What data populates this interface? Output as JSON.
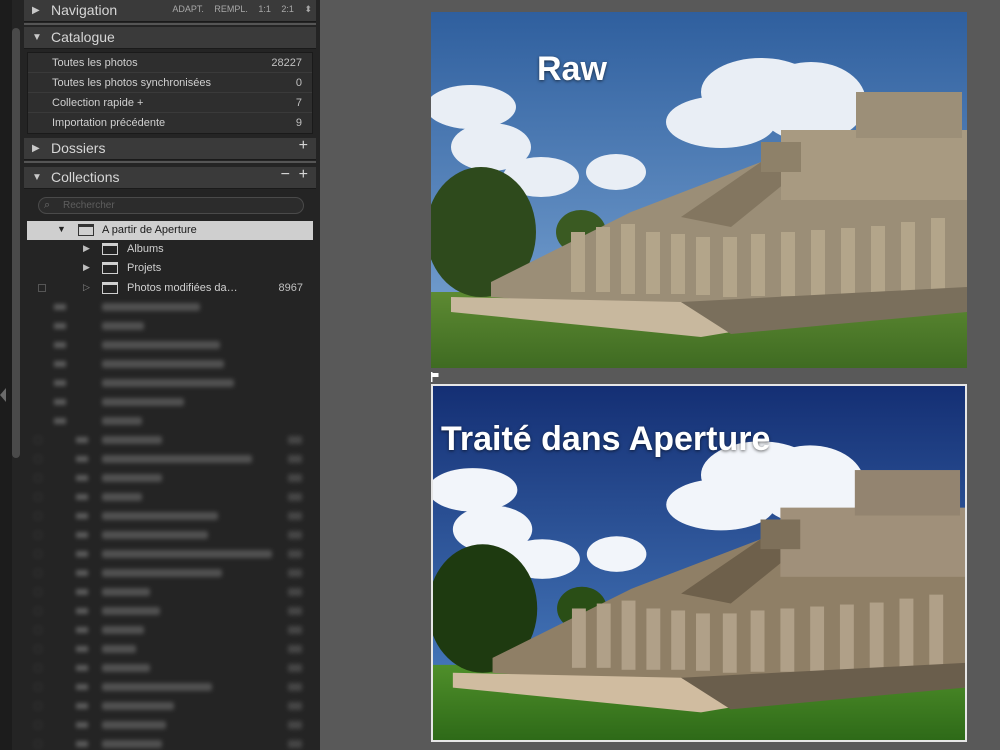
{
  "navigation": {
    "title": "Navigation",
    "options": [
      "ADAPT.",
      "REMPL.",
      "1:1",
      "2:1"
    ]
  },
  "catalogue": {
    "title": "Catalogue",
    "rows": [
      {
        "label": "Toutes les photos",
        "count": "28227"
      },
      {
        "label": "Toutes les photos synchronisées",
        "count": "0"
      },
      {
        "label": "Collection rapide +",
        "count": "7"
      },
      {
        "label": "Importation précédente",
        "count": "9"
      }
    ]
  },
  "dossiers": {
    "title": "Dossiers",
    "add": "+"
  },
  "collections": {
    "title": "Collections",
    "remove": "−",
    "add": "+",
    "search_placeholder": "Rechercher",
    "tree": [
      {
        "label": "A partir de Aperture",
        "count": ""
      },
      {
        "label": "Albums",
        "count": ""
      },
      {
        "label": "Projets",
        "count": ""
      },
      {
        "label": "Photos modifiées da…",
        "count": "8967"
      }
    ]
  },
  "photos": {
    "raw_label": "Raw",
    "processed_label": "Traité dans Aperture"
  },
  "icons": {
    "expanded": "triangle-down-icon",
    "collapsed": "triangle-right-icon",
    "collection_set": "box-icon",
    "search": "search-icon",
    "flag": "flag-icon"
  },
  "colors": {
    "panel_bg": "#242424",
    "header_bg": "#3a3a3a",
    "main_bg": "#595959",
    "selected_row": "#cfcfcf"
  }
}
